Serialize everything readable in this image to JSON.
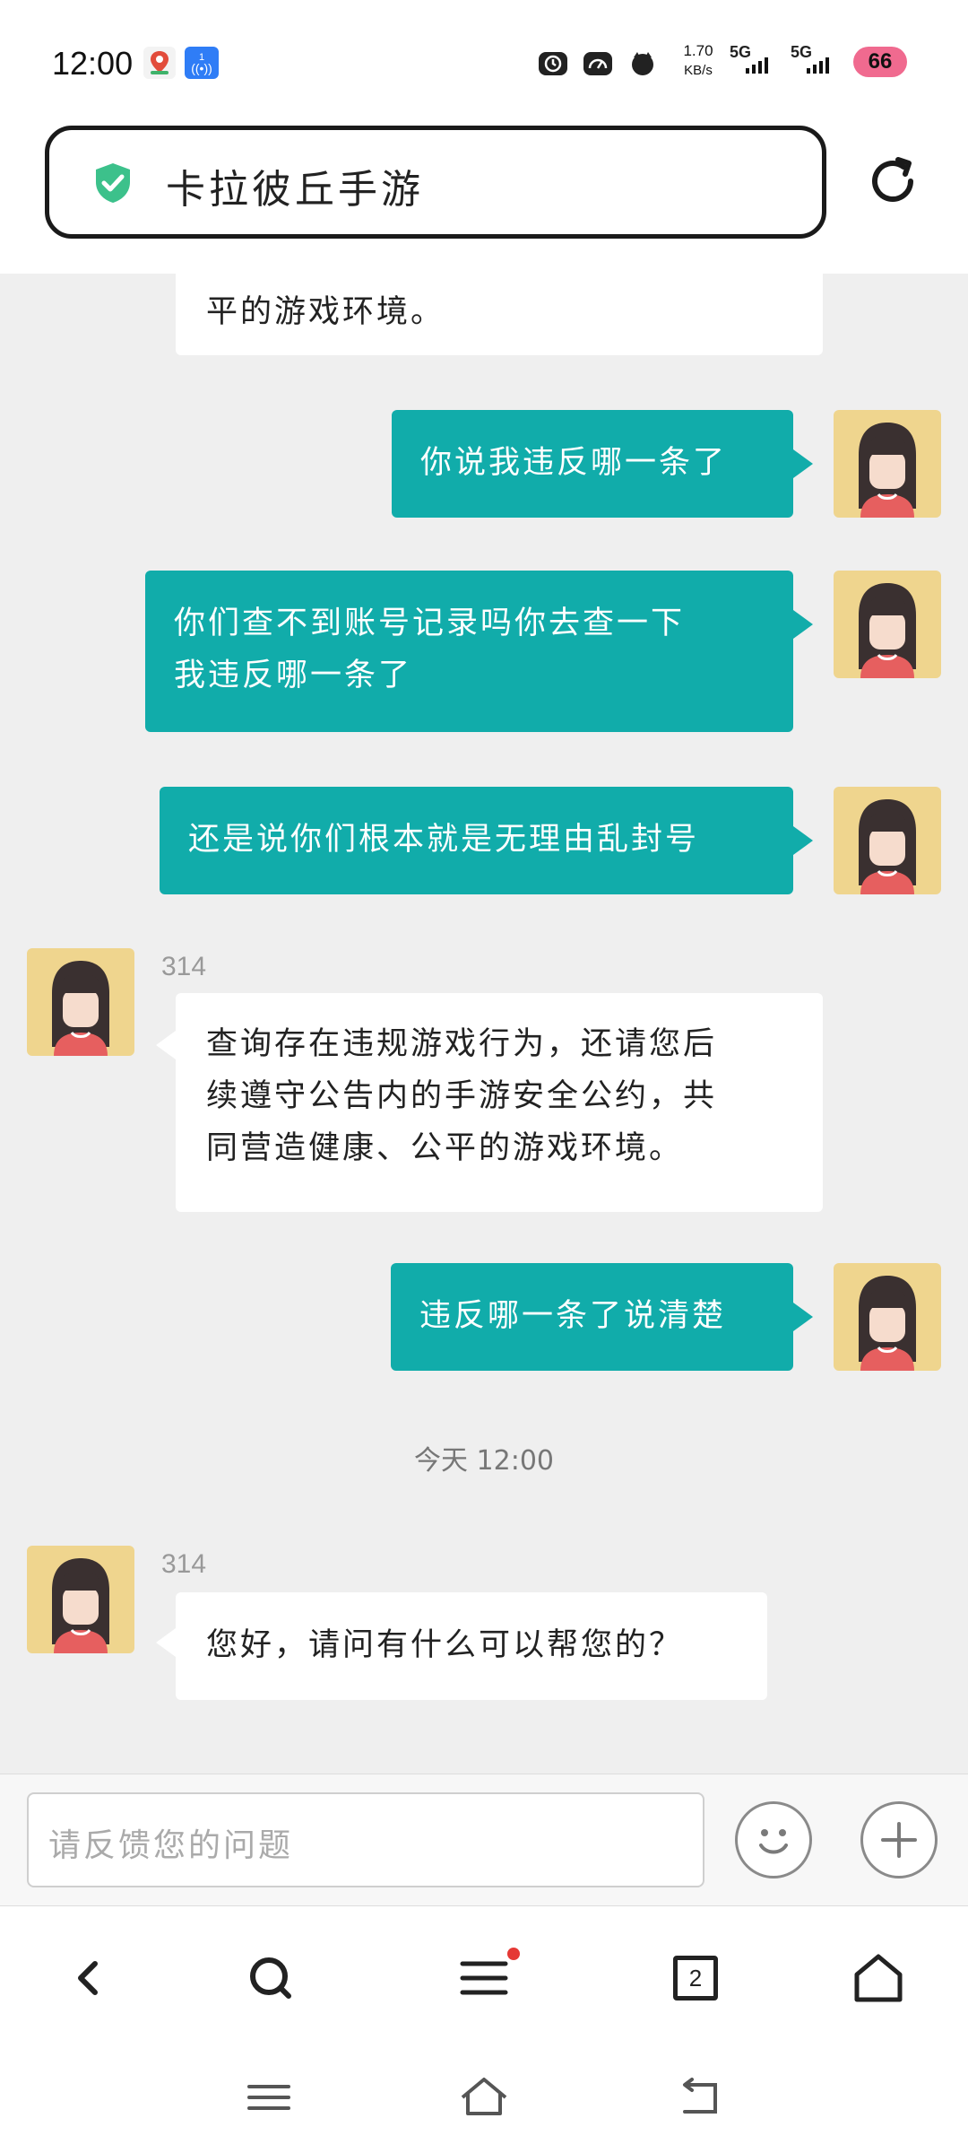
{
  "status_bar": {
    "time": "12:00",
    "net_speed_value": "1.70",
    "net_speed_unit": "KB/s",
    "signal_1": "5G",
    "signal_2": "5G",
    "battery": "66",
    "notif_badge": "1"
  },
  "address_bar": {
    "title": "卡拉彼丘手游",
    "secure_icon": "shield-check-icon",
    "refresh_icon": "refresh-icon"
  },
  "chat": {
    "messages": [
      {
        "side": "in",
        "text_lines": [
          "平的游戏环境。"
        ]
      },
      {
        "side": "out",
        "text_lines": [
          "你说我违反哪一条了"
        ]
      },
      {
        "side": "out",
        "text_lines": [
          "你们查不到账号记录吗你去查一下",
          "我违反哪一条了"
        ]
      },
      {
        "side": "out",
        "text_lines": [
          "还是说你们根本就是无理由乱封号"
        ]
      },
      {
        "side": "in",
        "sender": "314",
        "text_lines": [
          "查询存在违规游戏行为，还请您后",
          "续遵守公告内的手游安全公约，共",
          "同营造健康、公平的游戏环境。"
        ]
      },
      {
        "side": "out",
        "text_lines": [
          "违反哪一条了说清楚"
        ]
      },
      {
        "side": "in",
        "sender": "314",
        "text_lines": [
          "您好，请问有什么可以帮您的？"
        ]
      }
    ],
    "timestamp": "今天 12:00"
  },
  "composer": {
    "placeholder": "请反馈您的问题",
    "emoji_icon": "smiley-icon",
    "plus_icon": "plus-icon"
  },
  "browser_nav": {
    "tab_count": "2",
    "icons": [
      "back-icon",
      "search-icon",
      "menu-icon",
      "tabs-icon",
      "home-icon"
    ]
  },
  "colors": {
    "accent_teal": "#11acaa",
    "chat_bg": "#efefef",
    "avatar_bg": "#efd58e",
    "notification_dot": "#e53935"
  }
}
